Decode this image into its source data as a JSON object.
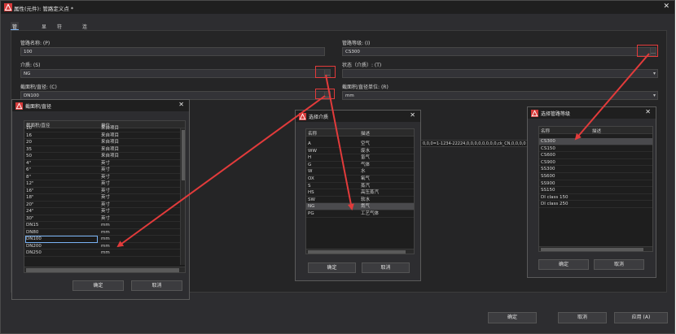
{
  "main": {
    "title": "属性(元件): 管路定义点 *",
    "tabs": [
      "管线定义",
      "显示",
      "符号数据",
      "连接图形"
    ],
    "fields": {
      "pipe_name_label": "管路名称: (P)",
      "pipe_name_value": "100",
      "pipe_class_label": "管路等级: (I)",
      "pipe_class_value": "CS300",
      "medium_label": "介质: (S)",
      "medium_value": "NG",
      "state_label": "状态（介质）: (T)",
      "section_label": "截面积/直径: (C)",
      "section_value": "DN100",
      "section_unit_label": "截面积/直径单位: (R)",
      "section_unit_value": "mm",
      "background_text": "0,0,0=1-1234-22224,0,0,0,0,0,0,0,0,ck_CN,0,0,0,0"
    },
    "buttons": {
      "ok": "确定",
      "cancel": "取消",
      "apply": "应用 (A)"
    }
  },
  "dialog_section": {
    "title": "截面积/直径",
    "columns": [
      "截面积/直径",
      "单位"
    ],
    "rows": [
      [
        "10",
        "来自项目"
      ],
      [
        "16",
        "来自项目"
      ],
      [
        "20",
        "来自项目"
      ],
      [
        "35",
        "来自项目"
      ],
      [
        "50",
        "来自项目"
      ],
      [
        "4\"",
        "英寸"
      ],
      [
        "6\"",
        "英寸"
      ],
      [
        "8\"",
        "英寸"
      ],
      [
        "12\"",
        "英寸"
      ],
      [
        "16\"",
        "英寸"
      ],
      [
        "18\"",
        "英寸"
      ],
      [
        "20\"",
        "英寸"
      ],
      [
        "24\"",
        "英寸"
      ],
      [
        "30\"",
        "英寸"
      ],
      [
        "DN15",
        "mm"
      ],
      [
        "DN80",
        "mm"
      ],
      [
        "DN100",
        "mm"
      ],
      [
        "DN200",
        "mm"
      ],
      [
        "DN250",
        "mm"
      ]
    ],
    "ok": "确定",
    "cancel": "取消"
  },
  "dialog_medium": {
    "title": "选择介质",
    "columns": [
      "名称",
      "描述"
    ],
    "rows": [
      [
        "A",
        "空气"
      ],
      [
        "WW",
        "废水"
      ],
      [
        "H",
        "氢气"
      ],
      [
        "G",
        "气体"
      ],
      [
        "W",
        "水"
      ],
      [
        "OX",
        "氧气"
      ],
      [
        "S",
        "蒸汽"
      ],
      [
        "HS",
        "高压蒸汽"
      ],
      [
        "SW",
        "软水"
      ],
      [
        "NG",
        "氮气"
      ],
      [
        "PG",
        "工艺气体"
      ]
    ],
    "ok": "确定",
    "cancel": "取消"
  },
  "dialog_class": {
    "title": "选择管路等级",
    "columns": [
      "名称",
      "描述"
    ],
    "rows": [
      [
        "CS300"
      ],
      [
        "CS150"
      ],
      [
        "CS600"
      ],
      [
        "CS900"
      ],
      [
        "SS300"
      ],
      [
        "SS600"
      ],
      [
        "SS900"
      ],
      [
        "SS150"
      ],
      [
        "DI class 150"
      ],
      [
        "DI class 250"
      ]
    ],
    "ok": "确定",
    "cancel": "取消"
  },
  "colors": {
    "annotation": "#e23b3b",
    "selection_border": "#7ab3f5"
  },
  "icons": [
    "app-logo-icon",
    "close-icon",
    "dropdown-arrow-icon"
  ]
}
